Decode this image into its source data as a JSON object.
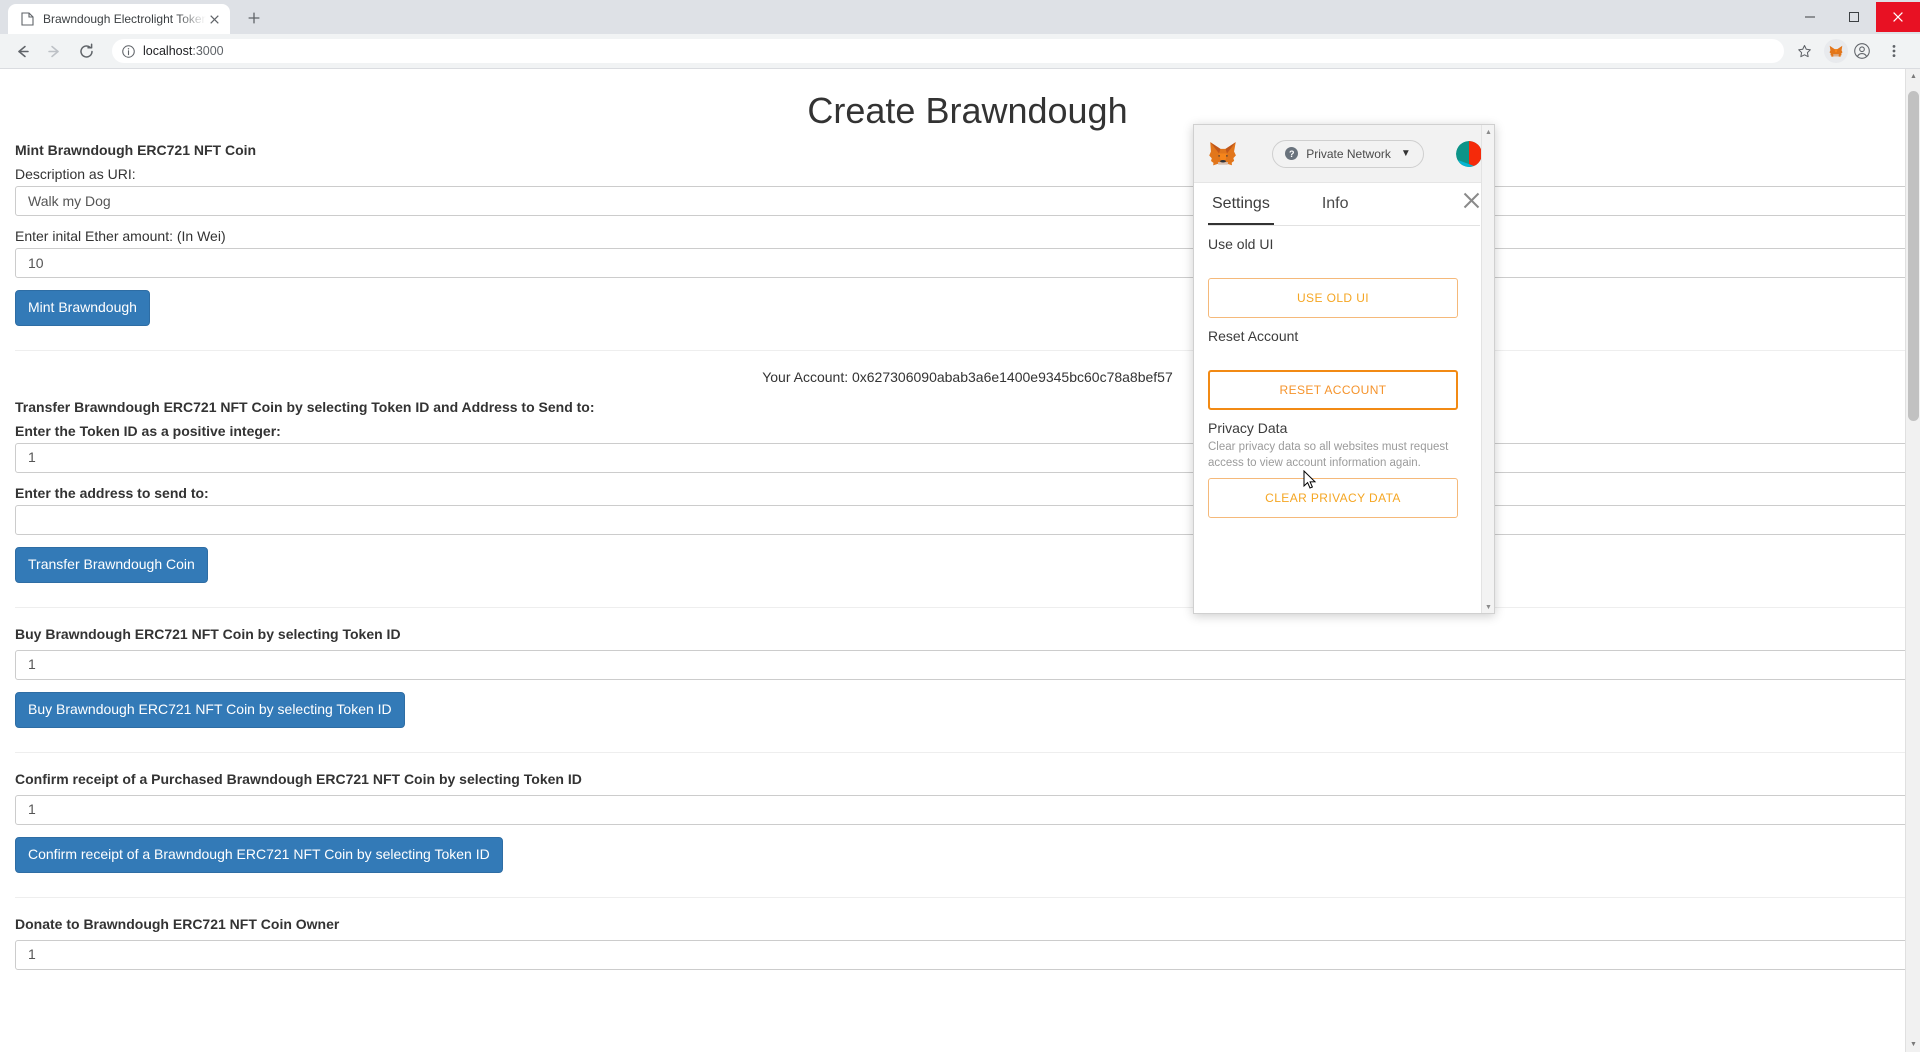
{
  "browser": {
    "tab": {
      "title": "Brawndough Electrolight Token",
      "favicon_icon": "page-icon",
      "close_icon": "close-icon"
    },
    "new_tab_icon": "plus-icon",
    "window_controls": {
      "minimize_icon": "minimize-icon",
      "maximize_icon": "maximize-icon",
      "close_icon": "window-close-icon"
    },
    "toolbar": {
      "back_icon": "back-arrow-icon",
      "forward_icon": "forward-arrow-icon",
      "reload_icon": "reload-icon",
      "info_icon": "info-circle-icon",
      "url_host": "localhost",
      "url_rest": ":3000",
      "star_icon": "bookmark-star-icon",
      "extension_icon": "metamask-extension-icon",
      "profile_icon": "profile-avatar-icon",
      "menu_icon": "three-dot-menu-icon"
    }
  },
  "page": {
    "title": "Create Brawndough",
    "mint": {
      "heading": "Mint Brawndough ERC721 NFT Coin",
      "uri_label": "Description as URI:",
      "uri_value": "Walk my Dog",
      "ether_label": "Enter inital Ether amount: (In Wei)",
      "ether_value": "10",
      "button": "Mint Brawndough"
    },
    "account_line": "Your Account: 0x627306090abab3a6e1400e9345bc60c78a8bef57",
    "transfer": {
      "heading": "Transfer Brawndough ERC721 NFT Coin by selecting Token ID and Address to Send to:",
      "token_label": "Enter the Token ID as a positive integer:",
      "token_value": "1",
      "address_label": "Enter the address to send to:",
      "address_value": "",
      "button": "Transfer Brawndough Coin"
    },
    "buy": {
      "heading": "Buy Brawndough ERC721 NFT Coin by selecting Token ID",
      "token_value": "1",
      "button": "Buy Brawndough ERC721 NFT Coin by selecting Token ID"
    },
    "confirm": {
      "heading": "Confirm receipt of a Purchased Brawndough ERC721 NFT Coin by selecting Token ID",
      "token_value": "1",
      "button": "Confirm receipt of a Brawndough ERC721 NFT Coin by selecting Token ID"
    },
    "donate": {
      "heading": "Donate to Brawndough ERC721 NFT Coin Owner",
      "token_value": "1"
    },
    "colors": {
      "primary_button": "#337ab7",
      "primary_button_border": "#2e6da4"
    }
  },
  "metamask": {
    "fox_icon": "metamask-fox-icon",
    "network": {
      "help_icon": "question-mark-icon",
      "label": "Private Network",
      "caret_icon": "chevron-down-icon"
    },
    "identicon": "account-identicon",
    "tabs": [
      {
        "label": "Settings",
        "active": true
      },
      {
        "label": "Info",
        "active": false
      }
    ],
    "close_icon": "close-icon",
    "sections": [
      {
        "title": "Use old UI",
        "desc": "",
        "button": "USE OLD UI",
        "hover": false
      },
      {
        "title": "Reset Account",
        "desc": "",
        "button": "RESET ACCOUNT",
        "hover": true
      },
      {
        "title": "Privacy Data",
        "desc": "Clear privacy data so all websites must request access to view account information again.",
        "button": "CLEAR PRIVACY DATA",
        "hover": false
      }
    ],
    "colors": {
      "accent": "#f5a623",
      "accent_hover": "#f28a14"
    }
  }
}
